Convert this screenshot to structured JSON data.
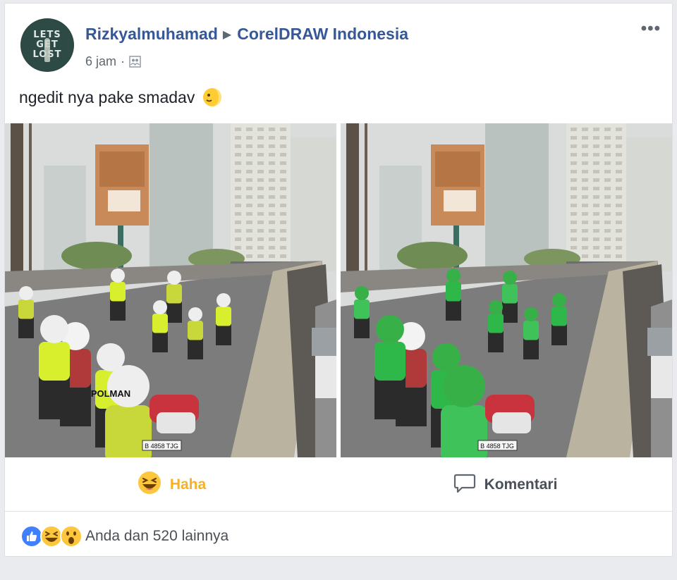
{
  "post": {
    "author": "Rizkyalmuhamad",
    "separator_icon": "triangle-right-icon",
    "group": "CorelDRAW Indonesia",
    "time": "6 jam",
    "meta_dot": "·",
    "audience_icon": "group-audience-icon",
    "more_label": "•••",
    "text": "ngedit nya pake smadav",
    "text_emoji": "moon-face-emoji",
    "avatar_text": [
      "LETS",
      "GET",
      "LOST"
    ]
  },
  "photos": [
    {
      "label": "original-photo",
      "vest_color": "#d8ef2e",
      "jacket_color": "#c8d83a",
      "helmet_color": "#eeeeee"
    },
    {
      "label": "edited-photo",
      "vest_color": "#2fb84a",
      "jacket_color": "#3fc25a",
      "helmet_color": "#37b048"
    }
  ],
  "plate_text": "B 4858 TJG",
  "vest_text": "POLMAN",
  "actions": {
    "haha_label": "Haha",
    "comment_label": "Komentari"
  },
  "reactions": {
    "summary": "Anda dan 520 lainnya",
    "icons": [
      "like-icon",
      "haha-icon",
      "wow-icon"
    ]
  },
  "colors": {
    "link": "#365899",
    "haha": "#f7b125",
    "like": "#4080ff"
  }
}
